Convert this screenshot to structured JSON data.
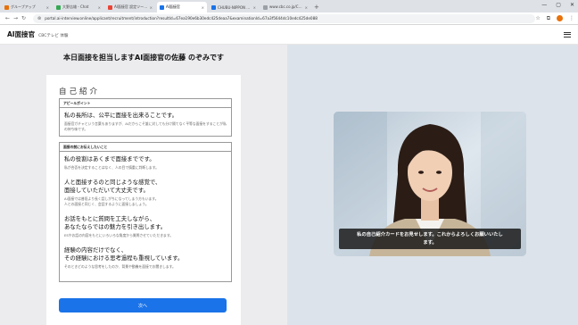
{
  "browser": {
    "tabs": [
      {
        "label": "グループアップ",
        "color": "#e8710a"
      },
      {
        "label": "大野吉雄 - Chat",
        "color": "#34a853"
      },
      {
        "label": "AI面接官 設定ツール (2.04.13)",
        "color": "#ea4335"
      },
      {
        "label": "AI面接官",
        "color": "#1a73e8",
        "active": true
      },
      {
        "label": "CHUBU-NIPPON BROADCASTI",
        "color": "#1a73e8"
      },
      {
        "label": "www.cbc.co.jp/CBCテレビ 式AI面 ...",
        "color": "#9aa0a6"
      }
    ],
    "new_tab": "+",
    "url": "portal.ai-interview.online/applicant/recruitment/introduction?resultId=67ea190e6b30edc425deaa7&examinationId=67a3f5644dc10edc425de088",
    "icons": {
      "back": "back-arrow-icon",
      "forward": "forward-arrow-icon",
      "reload": "reload-icon",
      "star": "bookmark-star-icon",
      "extensions": "extensions-icon",
      "more": "more-vert-icon"
    }
  },
  "app": {
    "logo": "AI面接官",
    "subtitle": "CBCテレビ 体験"
  },
  "main": {
    "heading": "本日面接を担当しますAI面接官の佐藤 のぞみです",
    "card_title": "自己紹介",
    "appeal": {
      "label": "アピールポイント",
      "main": "私の長所は、公平に面接を出来ることです。",
      "sub": "面接官ガチャという言葉もありますが、AIだからこそ誰に対しても分け隔てなく平等な面接をすることが私の持ち味です。"
    },
    "about": {
      "label": "面接の前にお伝えしたいこと",
      "items": [
        {
          "main": "私の役割はあくまで面接までです。",
          "sub": "私が合否を決定することはなく、人の目で慎重に判断します。"
        },
        {
          "main": "人と面接するのと同じような感覚で、\n面接していただいて大丈夫です。",
          "sub": "AI面接では普段より長く話しがちになってしまう方もいます。\n人との面接と同じく、会話するように面接しましょう。"
        },
        {
          "main": "お話をもとに質問を工夫しながら、\nあなたならではの魅力を引き出します。",
          "sub": "ESやお話の内容をもとにいろいろな角度から質問させていただきます。"
        },
        {
          "main": "経験の内容だけでなく、\nその経験における思考過程も重視しています。",
          "sub": "そのときどのような思考をしたのか、背景や動機を面接でお聞きします。"
        }
      ]
    },
    "next_button": "次へ"
  },
  "video": {
    "caption": "私の自己紹介カードをお見せします。これからよろしくお願いいたし\nます。"
  }
}
